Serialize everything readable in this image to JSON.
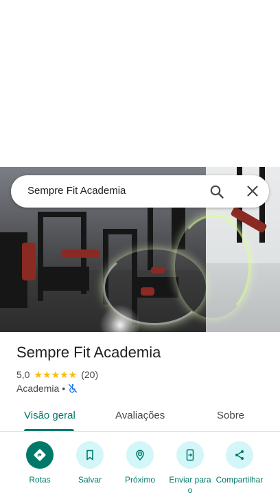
{
  "search": {
    "query": "Sempre Fit Academia"
  },
  "place": {
    "title": "Sempre Fit Academia",
    "rating": "5,0",
    "stars": "★★★★★",
    "review_count": "(20)",
    "category": "Academia",
    "separator": "•"
  },
  "tabs": [
    {
      "label": "Visão geral"
    },
    {
      "label": "Avaliações"
    },
    {
      "label": "Sobre"
    }
  ],
  "actions": [
    {
      "label": "Rotas",
      "icon": "directions-icon"
    },
    {
      "label": "Salvar",
      "icon": "bookmark-icon"
    },
    {
      "label": "Próximo",
      "icon": "nearby-icon"
    },
    {
      "label": "Enviar para o",
      "icon": "send-to-phone-icon"
    },
    {
      "label": "Compartilhar",
      "icon": "share-icon"
    }
  ],
  "colors": {
    "accent": "#00796b",
    "action_bg": "#d3f6f8",
    "star": "#fbbc04"
  }
}
